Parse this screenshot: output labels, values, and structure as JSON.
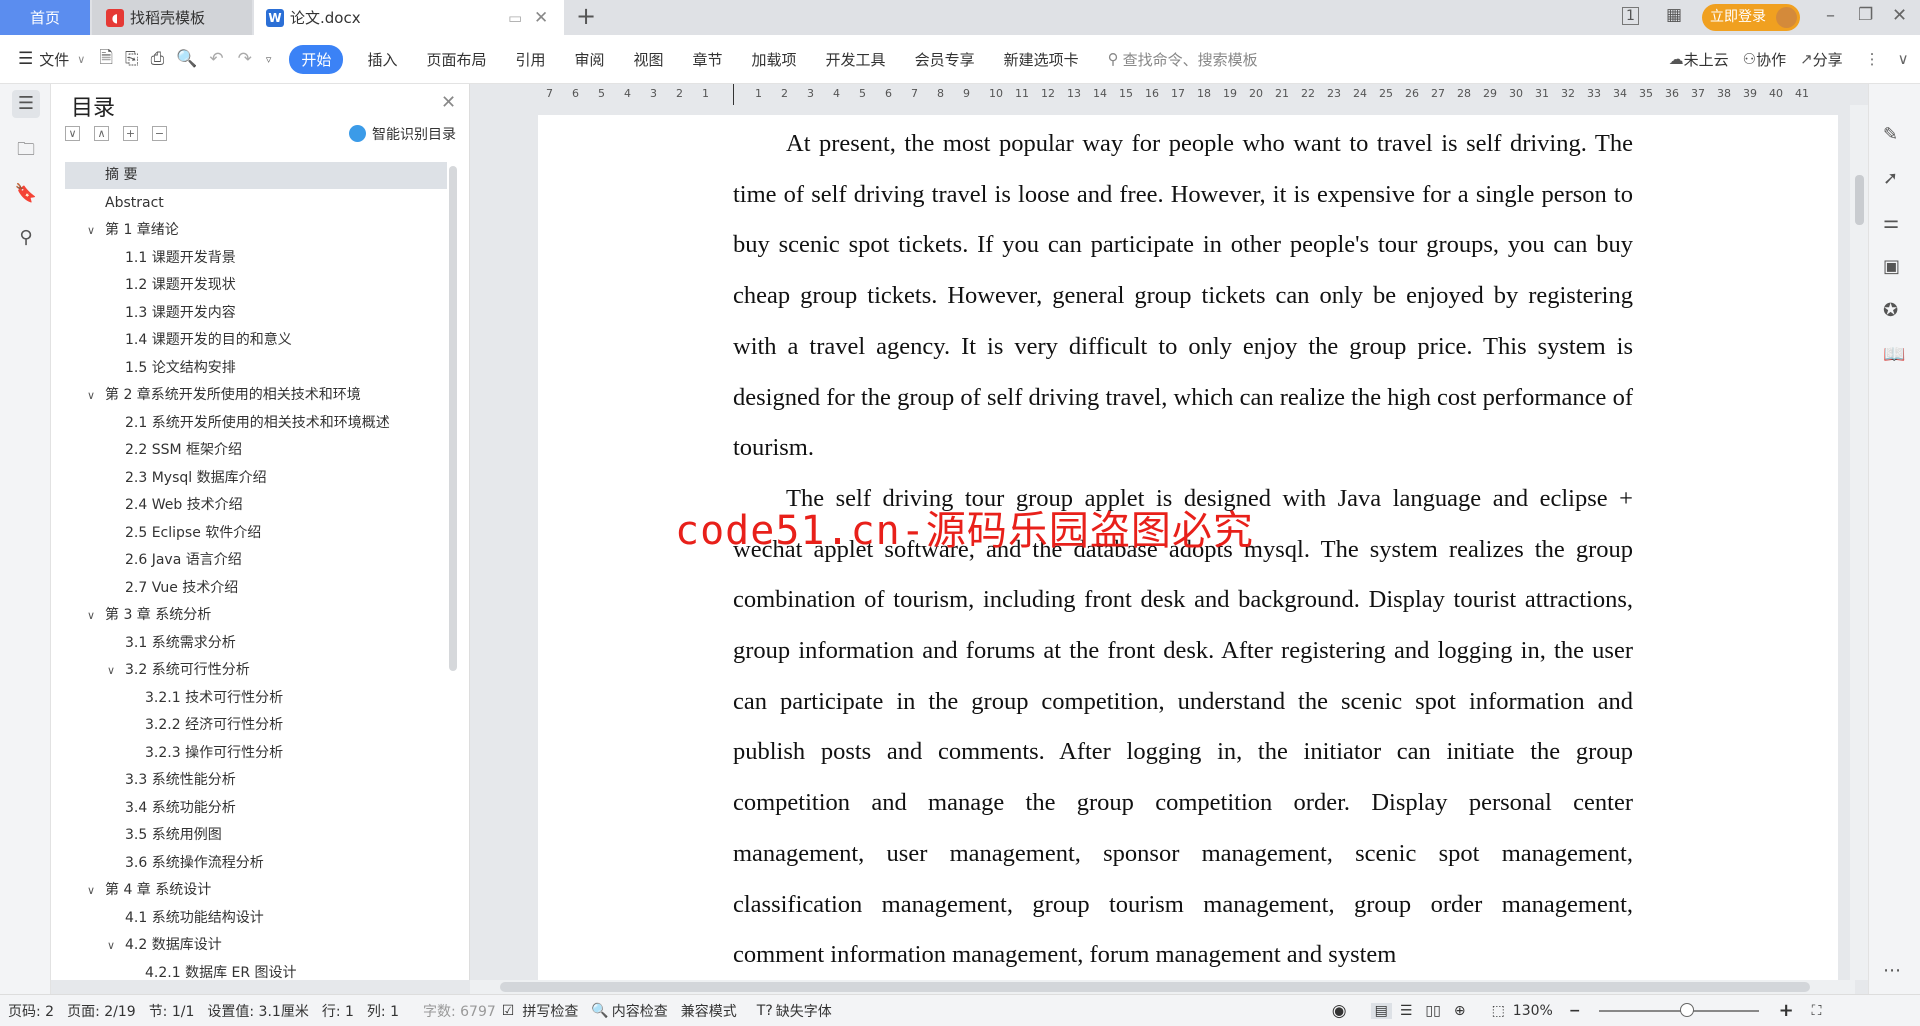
{
  "tabs": {
    "home": "首页",
    "template": "找稻壳模板",
    "document": "论文.docx",
    "new_tab": "+"
  },
  "window": {
    "login": "立即登录",
    "minimize": "–",
    "restore": "❐",
    "close": "✕"
  },
  "toolbar": {
    "file": "文件",
    "start": "开始",
    "items": [
      "插入",
      "页面布局",
      "引用",
      "审阅",
      "视图",
      "章节",
      "加载项",
      "开发工具",
      "会员专享",
      "新建选项卡"
    ],
    "search_placeholder": "查找命令、搜索模板",
    "cloud": "未上云",
    "collab": "协作",
    "share": "分享"
  },
  "toc": {
    "title": "目录",
    "smart": "智能识别目录",
    "items": [
      {
        "label": "摘  要",
        "level": 0,
        "selected": true
      },
      {
        "label": "Abstract",
        "level": 0
      },
      {
        "label": "第 1 章绪论",
        "level": 0,
        "expanded": true
      },
      {
        "label": "1.1 课题开发背景",
        "level": 1
      },
      {
        "label": "1.2 课题开发现状",
        "level": 1
      },
      {
        "label": "1.3 课题开发内容",
        "level": 1
      },
      {
        "label": "1.4 课题开发的目的和意义",
        "level": 1
      },
      {
        "label": "1.5 论文结构安排",
        "level": 1
      },
      {
        "label": "第 2 章系统开发所使用的相关技术和环境",
        "level": 0,
        "expanded": true
      },
      {
        "label": "2.1 系统开发所使用的相关技术和环境概述",
        "level": 1
      },
      {
        "label": "2.2 SSM 框架介绍",
        "level": 1
      },
      {
        "label": "2.3 Mysql 数据库介绍",
        "level": 1
      },
      {
        "label": "2.4 Web 技术介绍",
        "level": 1
      },
      {
        "label": "2.5 Eclipse 软件介绍",
        "level": 1
      },
      {
        "label": "2.6 Java 语言介绍",
        "level": 1
      },
      {
        "label": "2.7 Vue 技术介绍",
        "level": 1
      },
      {
        "label": "第 3 章  系统分析",
        "level": 0,
        "expanded": true
      },
      {
        "label": "3.1 系统需求分析",
        "level": 1
      },
      {
        "label": "3.2 系统可行性分析",
        "level": 1,
        "expanded": true
      },
      {
        "label": "3.2.1 技术可行性分析",
        "level": 2
      },
      {
        "label": "3.2.2 经济可行性分析",
        "level": 2
      },
      {
        "label": "3.2.3 操作可行性分析",
        "level": 2
      },
      {
        "label": "3.3 系统性能分析",
        "level": 1
      },
      {
        "label": "3.4  系统功能分析",
        "level": 1
      },
      {
        "label": "3.5 系统用例图",
        "level": 1
      },
      {
        "label": "3.6 系统操作流程分析",
        "level": 1
      },
      {
        "label": "第 4 章  系统设计",
        "level": 0,
        "expanded": true
      },
      {
        "label": "4.1 系统功能结构设计",
        "level": 1
      },
      {
        "label": "4.2 数据库设计",
        "level": 1,
        "expanded": true
      },
      {
        "label": "4.2.1 数据库 ER 图设计",
        "level": 2
      }
    ]
  },
  "ruler": {
    "left": [
      "7",
      "6",
      "5",
      "4",
      "3",
      "2",
      "1"
    ],
    "right_max": 41
  },
  "document": {
    "paragraphs": [
      "At present, the most popular way for people who want to travel is self driving. The time of self driving travel is loose and free. However, it is expensive for a single person to buy scenic spot tickets. If you can participate in other people's tour groups, you can buy cheap group tickets. However, general group tickets can only be enjoyed by registering with a travel agency. It is very difficult to only enjoy the group price. This system is designed for the group of self driving travel, which can realize the high cost performance of tourism.",
      "The self driving tour group applet is designed with Java language and eclipse + wechat applet software, and the database adopts mysql. The system realizes the group combination of tourism, including front desk and background. Display tourist attractions, group information and forums at the front desk. After registering and logging in, the user can participate in the group competition, understand the scenic spot information and publish posts and comments. After logging in, the initiator can initiate the group competition and manage the group competition order. Display personal center management, user management, sponsor management, scenic spot management, classification management, group tourism management, group order management, comment information management, forum management and system"
    ],
    "watermark": "code51.cn-源码乐园盗图必究"
  },
  "status": {
    "page_code": "页码: 2",
    "page": "页面: 2/19",
    "section": "节: 1/1",
    "setting": "设置值: 3.1厘米",
    "row": "行: 1",
    "col": "列: 1",
    "word_count": "字数: 6797",
    "spell": "拼写检查",
    "content_check": "内容检查",
    "compat": "兼容模式",
    "missing_font": "缺失字体",
    "zoom": "130%",
    "zoom_level": 0.55
  },
  "colors": {
    "accent": "#3b82f6",
    "login": "#f0a020",
    "watermark": "#e8201a"
  }
}
